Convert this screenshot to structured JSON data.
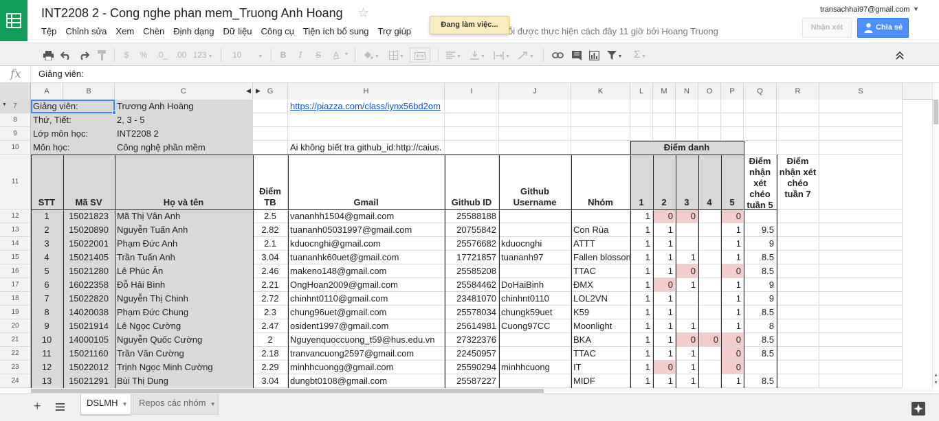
{
  "doc": {
    "title": "INT2208 2 - Cong nghe phan mem_Truong Anh Hoang",
    "last_edit": "ỗi được thực hiện cách đây 11 giờ bởi Hoang Truong",
    "status_toast": "Đang làm việc..."
  },
  "menu": [
    "Tệp",
    "Chỉnh sửa",
    "Xem",
    "Chèn",
    "Định dạng",
    "Dữ liệu",
    "Công cụ",
    "Tiện ích bổ sung",
    "Trợ giúp"
  ],
  "account": {
    "email": "transachhai97@gmail.com",
    "comments_label": "Nhận xét",
    "share_label": "Chia sẻ"
  },
  "toolbar": {
    "currency": "$",
    "percent": "%",
    "dec_less": ".0_",
    "dec_more": ".00",
    "format_more": "123",
    "font_size": "10",
    "bold": "B",
    "italic": "I",
    "strike": "S",
    "text_color": "A",
    "sum": "Σ"
  },
  "formula_bar": {
    "content": "Giảng viên:"
  },
  "columns": [
    "A",
    "B",
    "C",
    "G",
    "H",
    "I",
    "J",
    "K",
    "L",
    "M",
    "N",
    "O",
    "P",
    "Q",
    "R",
    "S"
  ],
  "row_numbers": [
    "7",
    "8",
    "9",
    "10",
    "11",
    "12",
    "13",
    "14",
    "15",
    "16",
    "17",
    "18",
    "19",
    "20",
    "21",
    "22",
    "23",
    "24"
  ],
  "info_rows": [
    {
      "label": "Giảng viên:",
      "value": "Trương Anh Hoàng",
      "note": "https://piazza.com/class/iynx56bd2om"
    },
    {
      "label": "Thứ, Tiết:",
      "value": "2, 3 - 5",
      "note": ""
    },
    {
      "label": "Lớp môn học:",
      "value": "INT2208 2",
      "note": ""
    },
    {
      "label": "Môn học:",
      "value": "Công nghệ phần mềm",
      "note": "Ai không biết tra github_id:http://caius."
    }
  ],
  "attendance_header": "Điểm danh",
  "headers": {
    "stt": "STT",
    "ma_sv": "Mã SV",
    "ho_ten": "Họ và tên",
    "diem_tb": "Điểm TB",
    "gmail": "Gmail",
    "github_id": "Github ID",
    "github_user": "Github Username",
    "nhom": "Nhóm",
    "sessions": [
      "1",
      "2",
      "3",
      "4",
      "5"
    ],
    "cross5": "Điểm nhận xét chéo tuần 5",
    "cross7": "Điểm nhận xét chéo tuần 7"
  },
  "students": [
    {
      "stt": "1",
      "ma_sv": "15021823",
      "ho_ten": "Mã Thị Vân Anh",
      "diem_tb": "2.5",
      "gmail": "vananhh1504@gmail.com",
      "github_id": "25588188",
      "github_user": "",
      "nhom": "",
      "att": [
        "1",
        "0",
        "0",
        "",
        "0"
      ],
      "cross5": ""
    },
    {
      "stt": "2",
      "ma_sv": "15020890",
      "ho_ten": "Nguyễn Tuấn Anh",
      "diem_tb": "2.82",
      "gmail": "tuananh05031997@gmail.com",
      "github_id": "20755842",
      "github_user": "",
      "nhom": "Con Rùa",
      "att": [
        "1",
        "1",
        "",
        "",
        "1"
      ],
      "cross5": "9.5"
    },
    {
      "stt": "3",
      "ma_sv": "15022001",
      "ho_ten": "Phạm Đức Anh",
      "diem_tb": "2.1",
      "gmail": "kduocnghi@gmail.com",
      "github_id": "25576682",
      "github_user": "kduocnghi",
      "nhom": "ATTT",
      "att": [
        "1",
        "1",
        "",
        "",
        "1"
      ],
      "cross5": "9"
    },
    {
      "stt": "4",
      "ma_sv": "15021405",
      "ho_ten": "Trần Tuấn Anh",
      "diem_tb": "3.04",
      "gmail": "tuananhk60uet@gmail.com",
      "github_id": "17721857",
      "github_user": "tuananh97",
      "nhom": "Fallen blossom",
      "att": [
        "1",
        "1",
        "1",
        "",
        "1"
      ],
      "cross5": "8.5"
    },
    {
      "stt": "5",
      "ma_sv": "15021280",
      "ho_ten": "Lê Phúc Ân",
      "diem_tb": "2.46",
      "gmail": "makeno148@gmail.com",
      "github_id": "25585208",
      "github_user": "",
      "nhom": "TTAC",
      "att": [
        "1",
        "1",
        "0",
        "",
        "0"
      ],
      "cross5": "8.5"
    },
    {
      "stt": "6",
      "ma_sv": "16022358",
      "ho_ten": "Đỗ Hải Bình",
      "diem_tb": "2.21",
      "gmail": "OngHoan2009@gmail.com",
      "github_id": "25584462",
      "github_user": "DoHaiBinh",
      "nhom": "ĐMX",
      "att": [
        "1",
        "0",
        "1",
        "",
        "1"
      ],
      "cross5": "9"
    },
    {
      "stt": "7",
      "ma_sv": "15022820",
      "ho_ten": "Nguyễn Thị Chinh",
      "diem_tb": "2.72",
      "gmail": "chinhnt0110@gmail.com",
      "github_id": "23481070",
      "github_user": "chinhnt0110",
      "nhom": "LOL2VN",
      "att": [
        "1",
        "1",
        "",
        "",
        "1"
      ],
      "cross5": "9"
    },
    {
      "stt": "8",
      "ma_sv": "14020038",
      "ho_ten": "Phạm Đức Chung",
      "diem_tb": "2.3",
      "gmail": "chung96uet@gmail.com",
      "github_id": "25578034",
      "github_user": "chungk59uet",
      "nhom": "K59",
      "att": [
        "1",
        "1",
        "",
        "",
        "1"
      ],
      "cross5": "8.5"
    },
    {
      "stt": "9",
      "ma_sv": "15021914",
      "ho_ten": "Lê Ngọc Cường",
      "diem_tb": "2.47",
      "gmail": "osident1997@gmail.com",
      "github_id": "25614981",
      "github_user": "Cuong97CC",
      "nhom": "Moonlight",
      "att": [
        "1",
        "1",
        "1",
        "",
        "1"
      ],
      "cross5": "8"
    },
    {
      "stt": "10",
      "ma_sv": "14000105",
      "ho_ten": "Nguyễn Quốc Cường",
      "diem_tb": "2",
      "gmail": "Nguyenquoccuong_t59@hus.edu.vn",
      "github_id": "27322376",
      "github_user": "",
      "nhom": "BKA",
      "att": [
        "1",
        "1",
        "0",
        "0",
        "0"
      ],
      "cross5": "8.5"
    },
    {
      "stt": "11",
      "ma_sv": "15021160",
      "ho_ten": "Trần Văn Cường",
      "diem_tb": "2.18",
      "gmail": "tranvancuong2597@gmail.com",
      "github_id": "22450957",
      "github_user": "",
      "nhom": "TTAC",
      "att": [
        "1",
        "1",
        "1",
        "",
        "0"
      ],
      "cross5": "8.5"
    },
    {
      "stt": "12",
      "ma_sv": "15022012",
      "ho_ten": "Trịnh Ngọc Minh Cường",
      "diem_tb": "2.29",
      "gmail": "minhhcuongg@gmail.com",
      "github_id": "25590294",
      "github_user": "minhhcuong",
      "nhom": "IT",
      "att": [
        "1",
        "0",
        "1",
        "",
        "0"
      ],
      "cross5": ""
    },
    {
      "stt": "13",
      "ma_sv": "15021291",
      "ho_ten": "Bùi Thị Dung",
      "diem_tb": "3.04",
      "gmail": "dungbt0108@gmail.com",
      "github_id": "25587227",
      "github_user": "",
      "nhom": "MIDF",
      "att": [
        "1",
        "1",
        "1",
        "",
        "1"
      ],
      "cross5": "8.5"
    }
  ],
  "sheets": [
    {
      "name": "DSLMH",
      "active": true
    },
    {
      "name": "Repos các nhóm",
      "active": false
    }
  ],
  "colors": {
    "brand_green": "#0f9d58",
    "share_blue": "#4d90fe",
    "header_gray": "#d9d9d9",
    "absent_pink": "#f4cccc",
    "link_blue": "#1155cc"
  }
}
